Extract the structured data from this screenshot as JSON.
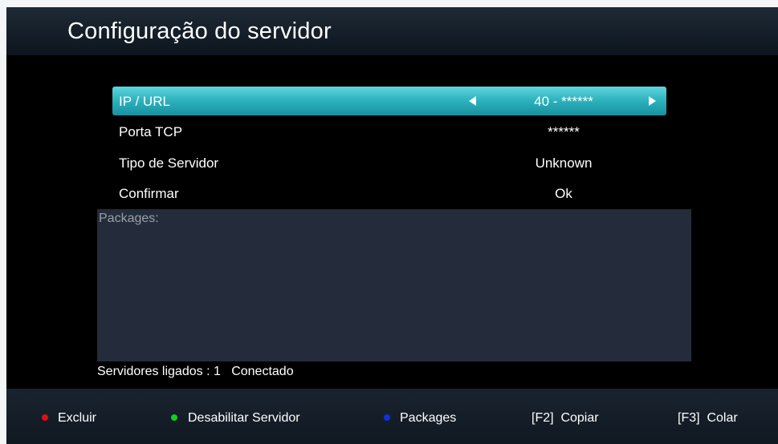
{
  "title": "Configuração do servidor",
  "menu": {
    "rows": [
      {
        "label": "IP / URL",
        "value": "40 - ******"
      },
      {
        "label": "Porta TCP",
        "value": "******"
      },
      {
        "label": "Tipo de Servidor",
        "value": "Unknown"
      },
      {
        "label": "Confirmar",
        "value": "Ok"
      }
    ]
  },
  "packages": {
    "label": "Packages:"
  },
  "status": {
    "text": "Servidores ligados : 1   Conectado"
  },
  "footer": {
    "items": [
      {
        "label": "Excluir",
        "color": "#e01010"
      },
      {
        "label": "Desabilitar Servidor",
        "color": "#10d020"
      },
      {
        "label": "Packages",
        "color": "#1030e0"
      },
      {
        "label": "[F2]  Copiar"
      },
      {
        "label": "[F3]  Colar"
      }
    ]
  },
  "icons": {
    "left_arrow": "left-arrow-icon",
    "right_arrow": "right-arrow-icon"
  },
  "colors": {
    "selection": "#2fb4c0",
    "packages_bg": "#242c3b",
    "background": "#000000"
  }
}
